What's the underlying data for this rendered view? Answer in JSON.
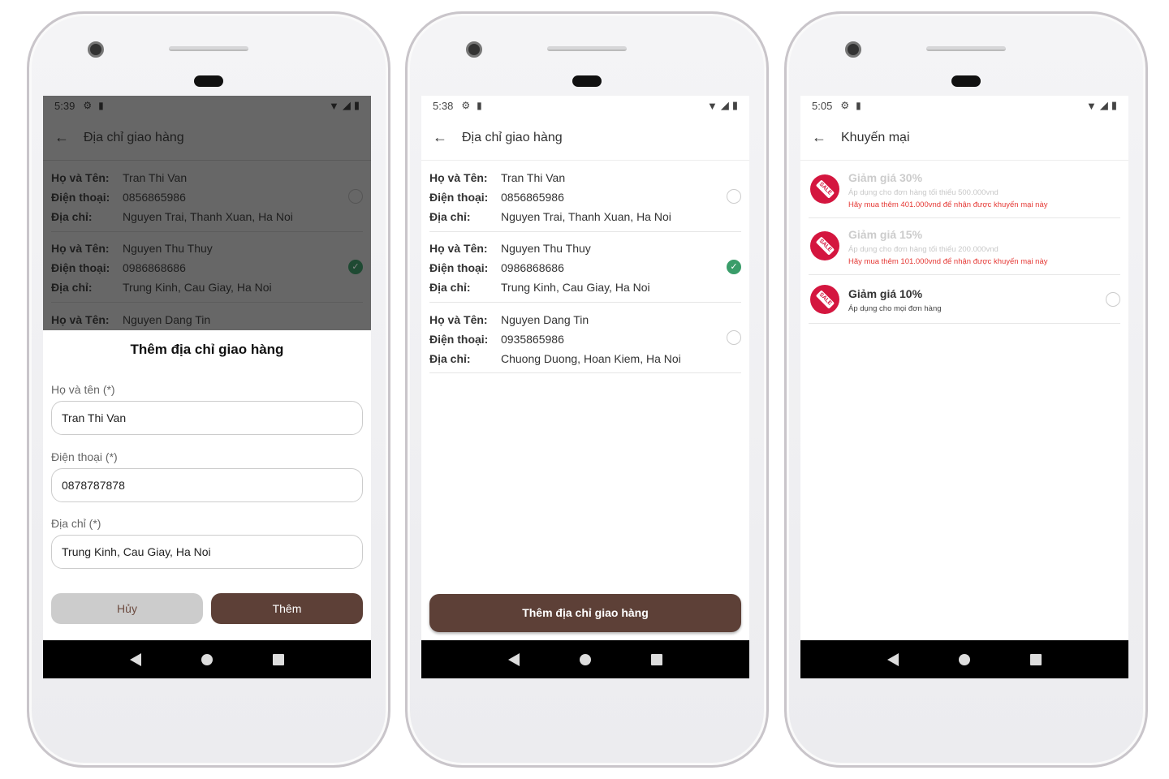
{
  "colors": {
    "primary": "#5d4037",
    "check": "#3a9d6a",
    "sale": "#d4163f",
    "warning": "#e53935"
  },
  "labels": {
    "name": "Họ và Tên:",
    "phone": "Điện thoại:",
    "address": "Địa chỉ:"
  },
  "phone1": {
    "time": "5:39",
    "title": "Địa chỉ giao hàng",
    "addresses": [
      {
        "name": "Tran Thi Van",
        "phone": "0856865986",
        "address": "Nguyen Trai, Thanh Xuan, Ha Noi",
        "selected": false
      },
      {
        "name": "Nguyen Thu Thuy",
        "phone": "0986868686",
        "address": "Trung Kinh, Cau Giay, Ha Noi",
        "selected": true
      },
      {
        "name": "Nguyen Dang Tin"
      }
    ],
    "sheet": {
      "title": "Thêm địa chỉ giao hàng",
      "name_label": "Họ và tên (*)",
      "name_value": "Tran Thi Van",
      "phone_label": "Điện thoại (*)",
      "phone_value": "0878787878",
      "address_label": "Địa chỉ (*)",
      "address_value": "Trung Kinh, Cau Giay, Ha Noi",
      "cancel": "Hủy",
      "submit": "Thêm"
    }
  },
  "phone2": {
    "time": "5:38",
    "title": "Địa chỉ giao hàng",
    "addresses": [
      {
        "name": "Tran Thi Van",
        "phone": "0856865986",
        "address": "Nguyen Trai, Thanh Xuan, Ha Noi",
        "selected": false
      },
      {
        "name": "Nguyen Thu Thuy",
        "phone": "0986868686",
        "address": "Trung Kinh, Cau Giay, Ha Noi",
        "selected": true
      },
      {
        "name": "Nguyen Dang Tin",
        "phone": "0935865986",
        "address": "Chuong Duong, Hoan Kiem, Ha Noi",
        "selected": false
      }
    ],
    "add_button": "Thêm địa chỉ giao hàng"
  },
  "phone3": {
    "time": "5:05",
    "title": "Khuyến mại",
    "badge_text": "SALE",
    "promos": [
      {
        "title": "Giảm giá 30%",
        "subtitle": "Áp dụng cho đơn hàng tối thiểu 500.000vnd",
        "warning": "Hãy mua thêm 401.000vnd để nhận được khuyến mại này",
        "enabled": false
      },
      {
        "title": "Giảm giá 15%",
        "subtitle": "Áp dụng cho đơn hàng tối thiểu 200.000vnd",
        "warning": "Hãy mua thêm 101.000vnd để nhận được khuyến mại này",
        "enabled": false
      },
      {
        "title": "Giảm giá 10%",
        "subtitle": "Áp dụng cho mọi đơn hàng",
        "enabled": true,
        "selected": false
      }
    ]
  }
}
